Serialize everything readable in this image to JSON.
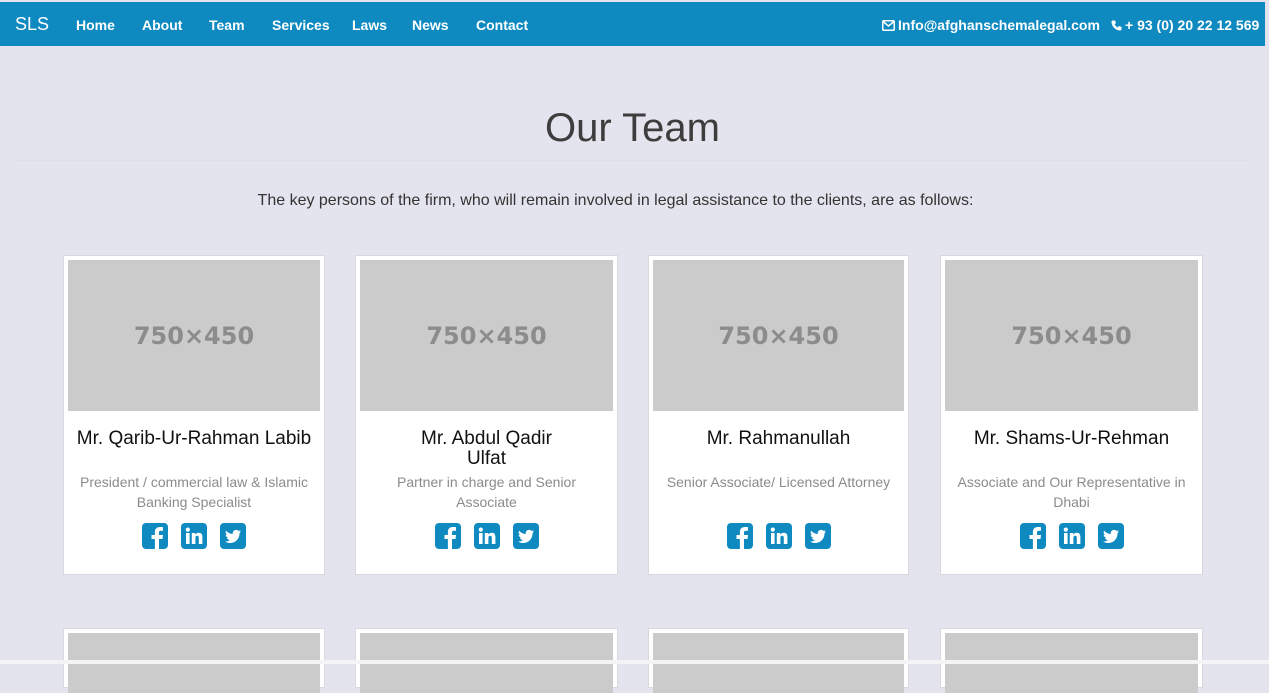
{
  "brand": "SLS",
  "nav": {
    "links": [
      "Home",
      "About",
      "Team",
      "Services",
      "Laws",
      "News",
      "Contact"
    ],
    "email": "Info@afghanschemalegal.com",
    "phone": "+ 93 (0) 20 22 12 569"
  },
  "page": {
    "title": "Our Team",
    "intro": "The key persons of the firm, who will remain involved in legal assistance to the clients, are as follows:"
  },
  "placeholder_text": "750×450",
  "team": [
    {
      "name": "Mr. Qarib-Ur-Rahman Labib",
      "role": "President / commercial law & Islamic Banking Specialist"
    },
    {
      "name": "Mr. Abdul Qadir Ulfat",
      "role": "Partner in charge and Senior Associate"
    },
    {
      "name": "Mr. Rahmanullah",
      "role": "Senior Associate/ Licensed Attorney"
    },
    {
      "name": "Mr. Shams-Ur-Rehman",
      "role": "Associate and Our Representative in Dhabi"
    }
  ],
  "icons": {
    "email": "envelope-icon",
    "phone": "phone-icon",
    "social": [
      "facebook-icon",
      "linkedin-icon",
      "twitter-icon"
    ]
  },
  "colors": {
    "nav_bg": "#0e8ac0",
    "page_bg": "#e4e4ee",
    "social_bg": "#0e8ac0",
    "placeholder_bg": "#cbcbcb"
  }
}
